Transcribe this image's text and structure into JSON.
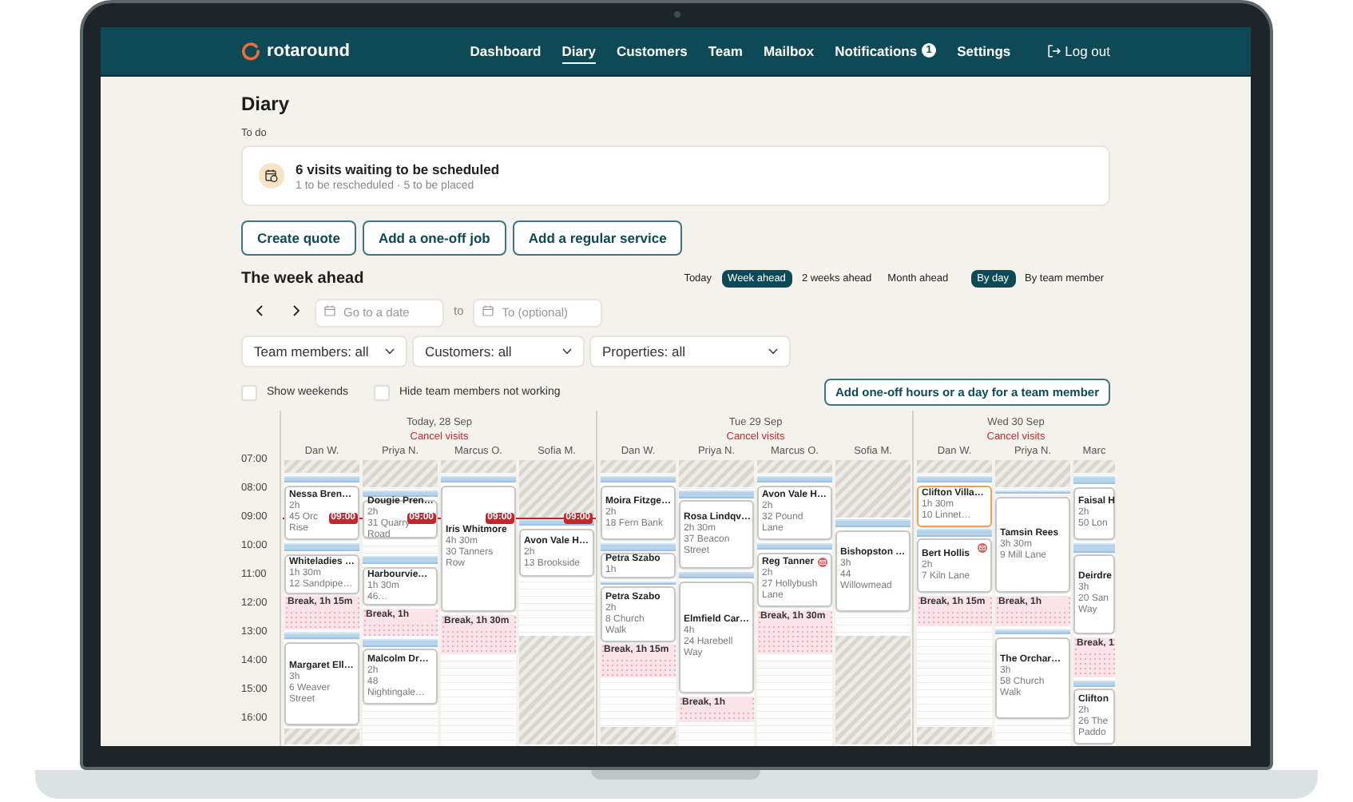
{
  "nav": {
    "logo": "rotaround",
    "items": [
      {
        "label": "Dashboard",
        "selected": false
      },
      {
        "label": "Diary",
        "selected": true
      },
      {
        "label": "Customers",
        "selected": false
      },
      {
        "label": "Team",
        "selected": false
      },
      {
        "label": "Mailbox",
        "selected": false
      },
      {
        "label": "Notifications",
        "selected": false,
        "badge": "1"
      },
      {
        "label": "Settings",
        "selected": false
      }
    ],
    "logout": "Log out"
  },
  "page": {
    "title": "Diary",
    "todo_label": "To do",
    "todo": {
      "title": "6 visits waiting to be scheduled",
      "subtitle": "1 to be rescheduled · 5 to be placed"
    },
    "actions": [
      "Create quote",
      "Add a one-off job",
      "Add a regular service"
    ]
  },
  "week": {
    "title": "The week ahead",
    "ranges": [
      {
        "label": "Today",
        "selected": false
      },
      {
        "label": "Week ahead",
        "selected": true
      },
      {
        "label": "2 weeks ahead",
        "selected": false
      },
      {
        "label": "Month ahead",
        "selected": false
      }
    ],
    "groupings": [
      {
        "label": "By day",
        "selected": true
      },
      {
        "label": "By team member",
        "selected": false
      }
    ],
    "date_from": {
      "placeholder": "Go to a date"
    },
    "to_label": "to",
    "date_to": {
      "placeholder": "To (optional)"
    },
    "filters": [
      "Team members: all",
      "Customers: all",
      "Properties: all"
    ],
    "options": [
      {
        "label": "Show weekends",
        "checked": false
      },
      {
        "label": "Hide team members not working",
        "checked": false
      }
    ],
    "add_hours": "Add one-off hours or a day for a team member"
  },
  "calendar": {
    "hours": [
      "07:00",
      "08:00",
      "09:00",
      "10:00",
      "11:00",
      "12:00",
      "13:00",
      "14:00",
      "15:00",
      "16:00"
    ],
    "days": [
      {
        "date": "Today, 28 Sep",
        "cancel": "Cancel visits",
        "columns": [
          {
            "member": "Dan W.",
            "now_label": "09:00",
            "blocks": [
              {
                "kind": "off"
              },
              {
                "kind": "travel"
              },
              {
                "kind": "visit",
                "customer": "Nessa Bren…",
                "duration": "2h",
                "address": [
                  "45 Orc",
                  "Rise"
                ],
                "highlighted": false,
                "message": false
              },
              {
                "kind": "travel"
              },
              {
                "kind": "visit",
                "customer": "Whiteladies …",
                "duration": "1h 30m",
                "address": [
                  "12 Sandpipe…"
                ],
                "highlighted": false,
                "message": false
              },
              {
                "kind": "break",
                "label": "Break, 1h 15m"
              },
              {
                "kind": "travel"
              },
              {
                "kind": "visit",
                "customer": "Margaret Ell…",
                "duration": "3h",
                "address": [
                  "6 Weaver",
                  "Street"
                ],
                "highlighted": false,
                "message": false
              },
              {
                "kind": "off"
              }
            ]
          },
          {
            "member": "Priya N.",
            "now_label": "09:00",
            "blocks": [
              {
                "kind": "off"
              },
              {
                "kind": "travel"
              },
              {
                "kind": "visit",
                "customer": "Dougie Pren…",
                "duration": "2h",
                "address": [
                  "31 Quarry",
                  "Road"
                ],
                "highlighted": false,
                "message": false
              },
              {
                "kind": "empty"
              },
              {
                "kind": "travel"
              },
              {
                "kind": "visit",
                "customer": "Harbourvie…",
                "duration": "1h 30m",
                "address": [
                  "46…"
                ],
                "highlighted": false,
                "message": false
              },
              {
                "kind": "break",
                "label": "Break, 1h"
              },
              {
                "kind": "travel"
              },
              {
                "kind": "visit",
                "customer": "Malcolm Dr…",
                "duration": "2h",
                "address": [
                  "48",
                  "Nightingale…"
                ],
                "highlighted": false,
                "message": false
              }
            ]
          },
          {
            "member": "Marcus O.",
            "now_label": "09:00",
            "blocks": [
              {
                "kind": "off"
              },
              {
                "kind": "travel"
              },
              {
                "kind": "visit",
                "customer": "Iris Whitmore",
                "duration": "4h 30m",
                "address": [
                  "30 Tanners",
                  "Row"
                ],
                "highlighted": false,
                "message": false
              },
              {
                "kind": "break",
                "label": "Break, 1h 30m"
              }
            ]
          },
          {
            "member": "Sofia M.",
            "now_label": "09:00",
            "blocks": [
              {
                "kind": "off"
              },
              {
                "kind": "travel"
              },
              {
                "kind": "visit",
                "customer": "Avon Vale H…",
                "duration": "2h",
                "address": [
                  "13 Brookside"
                ],
                "highlighted": false,
                "message": false
              },
              {
                "kind": "empty"
              },
              {
                "kind": "off"
              }
            ]
          }
        ]
      },
      {
        "date": "Tue 29 Sep",
        "cancel": "Cancel visits",
        "columns": [
          {
            "member": "Dan W.",
            "blocks": [
              {
                "kind": "off"
              },
              {
                "kind": "travel"
              },
              {
                "kind": "visit",
                "customer": "Moira Fitzge…",
                "duration": "2h",
                "address": [
                  "18 Fern Bank"
                ],
                "highlighted": false,
                "message": false
              },
              {
                "kind": "travel"
              },
              {
                "kind": "visit",
                "customer": "Petra Szabo",
                "duration": "1h",
                "highlighted": false,
                "message": false
              },
              {
                "kind": "travel"
              },
              {
                "kind": "visit",
                "customer": "Petra Szabo",
                "duration": "2h",
                "address": [
                  "8 Church",
                  "Walk"
                ],
                "highlighted": false,
                "message": false
              },
              {
                "kind": "break",
                "label": "Break, 1h 15m"
              },
              {
                "kind": "empty"
              },
              {
                "kind": "off"
              }
            ]
          },
          {
            "member": "Priya N.",
            "blocks": [
              {
                "kind": "off"
              },
              {
                "kind": "travel"
              },
              {
                "kind": "visit",
                "customer": "Rosa Lindqv…",
                "duration": "2h 30m",
                "address": [
                  "37 Beacon",
                  "Street"
                ],
                "highlighted": false,
                "message": false
              },
              {
                "kind": "travel"
              },
              {
                "kind": "visit",
                "customer": "Elmfield Car…",
                "duration": "4h",
                "address": [
                  "24 Harebell",
                  "Way"
                ],
                "highlighted": false,
                "message": false
              },
              {
                "kind": "break",
                "label": "Break, 1h"
              }
            ]
          },
          {
            "member": "Marcus O.",
            "blocks": [
              {
                "kind": "off"
              },
              {
                "kind": "travel"
              },
              {
                "kind": "visit",
                "customer": "Avon Vale H…",
                "duration": "2h",
                "address": [
                  "32 Pound",
                  "Lane"
                ],
                "highlighted": false,
                "message": false
              },
              {
                "kind": "travel"
              },
              {
                "kind": "visit",
                "customer": "Reg Tanner",
                "duration": "2h",
                "address": [
                  "27 Hollybush",
                  "Lane"
                ],
                "highlighted": false,
                "message": true
              },
              {
                "kind": "break",
                "label": "Break, 1h 30m"
              }
            ]
          },
          {
            "member": "Sofia M.",
            "blocks": [
              {
                "kind": "off"
              },
              {
                "kind": "travel"
              },
              {
                "kind": "visit",
                "customer": "Bishopston …",
                "duration": "3h",
                "address": [
                  "44",
                  "Willowmead"
                ],
                "highlighted": false,
                "message": false
              },
              {
                "kind": "empty"
              },
              {
                "kind": "off"
              }
            ]
          }
        ]
      },
      {
        "date": "Wed 30 Sep",
        "cancel": "Cancel visits",
        "columns": [
          {
            "member": "Dan W.",
            "blocks": [
              {
                "kind": "off"
              },
              {
                "kind": "travel"
              },
              {
                "kind": "visit",
                "customer": "Clifton Villa…",
                "duration": "1h 30m",
                "address": [
                  "10 Linnet…"
                ],
                "highlighted": true,
                "message": false
              },
              {
                "kind": "travel"
              },
              {
                "kind": "visit",
                "customer": "Bert Hollis",
                "duration": "2h",
                "address": [
                  "7 Kiln Lane"
                ],
                "highlighted": false,
                "message": true
              },
              {
                "kind": "break",
                "label": "Break, 1h 15m"
              },
              {
                "kind": "empty"
              },
              {
                "kind": "off"
              }
            ]
          },
          {
            "member": "Priya N.",
            "blocks": [
              {
                "kind": "off"
              },
              {
                "kind": "travel"
              },
              {
                "kind": "visit",
                "customer": "Tamsin Rees",
                "duration": "3h 30m",
                "address": [
                  "9 Mill Lane"
                ],
                "highlighted": false,
                "message": false
              },
              {
                "kind": "break",
                "label": "Break, 1h"
              },
              {
                "kind": "travel"
              },
              {
                "kind": "visit",
                "customer": "The Orchar…",
                "duration": "3h",
                "address": [
                  "58 Church",
                  "Walk"
                ],
                "highlighted": false,
                "message": false
              }
            ]
          },
          {
            "member": "Marc",
            "blocks": [
              {
                "kind": "off"
              },
              {
                "kind": "travel"
              },
              {
                "kind": "visit",
                "customer": "Faisal H",
                "duration": "2h",
                "address": [
                  "50 Lon"
                ],
                "highlighted": false,
                "message": false
              },
              {
                "kind": "travel"
              },
              {
                "kind": "visit",
                "customer": "Deirdre",
                "duration": "3h",
                "address": [
                  "20 San",
                  "Way"
                ],
                "highlighted": false,
                "message": false
              },
              {
                "kind": "break",
                "label": "Break, 1"
              },
              {
                "kind": "travel"
              },
              {
                "kind": "visit",
                "customer": "Clifton",
                "duration": "2h",
                "address": [
                  "26 The",
                  "Paddo"
                ],
                "highlighted": false,
                "message": false
              }
            ]
          }
        ]
      }
    ]
  }
}
